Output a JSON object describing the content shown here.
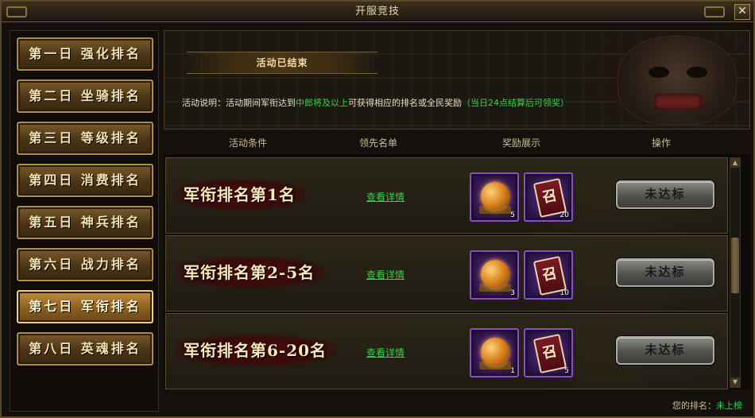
{
  "window": {
    "title": "开服竞技",
    "close_glyph": "✕"
  },
  "sidebar": {
    "tabs": [
      {
        "label": "第一日 强化排名",
        "active": false
      },
      {
        "label": "第二日 坐骑排名",
        "active": false
      },
      {
        "label": "第三日 等级排名",
        "active": false
      },
      {
        "label": "第四日 消费排名",
        "active": false
      },
      {
        "label": "第五日 神兵排名",
        "active": false
      },
      {
        "label": "第六日 战力排名",
        "active": false
      },
      {
        "label": "第七日 军衔排名",
        "active": true
      },
      {
        "label": "第八日 英魂排名",
        "active": false
      }
    ]
  },
  "banner": {
    "status": "活动已结束",
    "desc_prefix": "活动说明：活动期间军衔达到",
    "desc_highlight": "中郎将及以上",
    "desc_middle": "可获得相应的排名或全民奖励",
    "desc_note": "（当日24点结算后可领奖）"
  },
  "columns": {
    "condition": "活动条件",
    "leaders": "领先名单",
    "rewards": "奖励展示",
    "action": "操作"
  },
  "rows": [
    {
      "rank": "军衔排名第1名",
      "view": "查看详情",
      "items": [
        {
          "icon": "orb-icon",
          "qty": "5"
        },
        {
          "icon": "token-icon",
          "qty": "20",
          "glyph": "召"
        }
      ],
      "button": "未达标"
    },
    {
      "rank": "军衔排名第2-5名",
      "view": "查看详情",
      "items": [
        {
          "icon": "orb-icon",
          "qty": "3"
        },
        {
          "icon": "token-icon",
          "qty": "10",
          "glyph": "召"
        }
      ],
      "button": "未达标"
    },
    {
      "rank": "军衔排名第6-20名",
      "view": "查看详情",
      "items": [
        {
          "icon": "orb-icon",
          "qty": "1"
        },
        {
          "icon": "token-icon",
          "qty": "5",
          "glyph": "召"
        }
      ],
      "button": "未达标"
    }
  ],
  "footer": {
    "label": "您的排名：",
    "value": "未上榜"
  },
  "colors": {
    "highlight_green": "#35d046",
    "tab_gold": "#b08c48",
    "item_border_purple": "#8a4ec8"
  }
}
